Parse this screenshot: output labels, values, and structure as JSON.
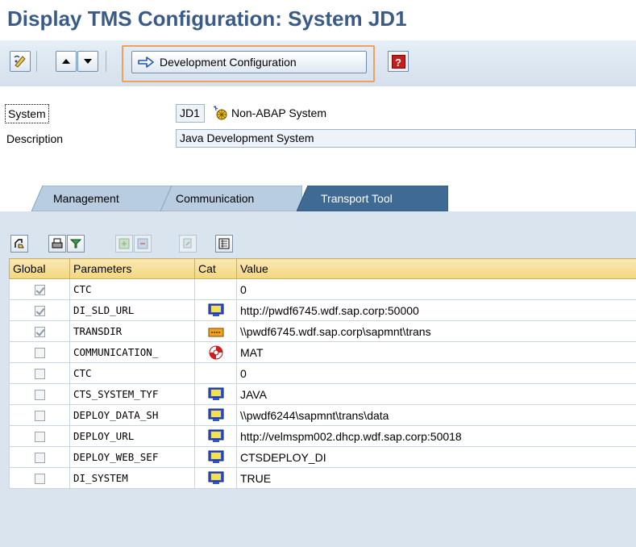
{
  "header": {
    "title": "Display TMS Configuration: System JD1"
  },
  "toolbar": {
    "dev_config_label": "Development Configuration",
    "icons": [
      "display-change-icon",
      "move-up-icon",
      "move-down-icon",
      "arrow-right-icon",
      "help-icon"
    ]
  },
  "form": {
    "system_label": "System",
    "system_value": "JD1",
    "system_type": "Non-ABAP System",
    "description_label": "Description",
    "description_value": "Java Development System"
  },
  "tabs": [
    {
      "label": "Management",
      "active": false
    },
    {
      "label": "Communication",
      "active": false
    },
    {
      "label": "Transport Tool",
      "active": true
    }
  ],
  "grid": {
    "columns": [
      "Global",
      "Parameters",
      "Cat",
      "Value"
    ],
    "rows": [
      {
        "global": true,
        "parameter": "CTC",
        "cat": "",
        "value": "0"
      },
      {
        "global": true,
        "parameter": "DI_SLD_URL",
        "cat": "user",
        "value": "http://pwdf6745.wdf.sap.corp:50000"
      },
      {
        "global": true,
        "parameter": "TRANSDIR",
        "cat": "system",
        "value": "\\\\pwdf6745.wdf.sap.corp\\sapmnt\\trans"
      },
      {
        "global": false,
        "parameter": "COMMUNICATION_",
        "cat": "lifebuoy",
        "value": "MAT"
      },
      {
        "global": false,
        "parameter": "CTC",
        "cat": "",
        "value": "0"
      },
      {
        "global": false,
        "parameter": "CTS_SYSTEM_TYF",
        "cat": "user",
        "value": "JAVA"
      },
      {
        "global": false,
        "parameter": "DEPLOY_DATA_SH",
        "cat": "user",
        "value": "\\\\pwdf6244\\sapmnt\\trans\\data"
      },
      {
        "global": false,
        "parameter": "DEPLOY_URL",
        "cat": "user",
        "value": "http://velmspm002.dhcp.wdf.sap.corp:50018"
      },
      {
        "global": false,
        "parameter": "DEPLOY_WEB_SEF",
        "cat": "user",
        "value": "CTSDEPLOY_DI"
      },
      {
        "global": false,
        "parameter": "DI_SYSTEM",
        "cat": "user",
        "value": "TRUE"
      }
    ]
  },
  "colors": {
    "title": "#3a5b87",
    "highlight_frame": "#f0a05a",
    "active_tab": "#3f6a93",
    "grid_header": "#f2d77e"
  }
}
